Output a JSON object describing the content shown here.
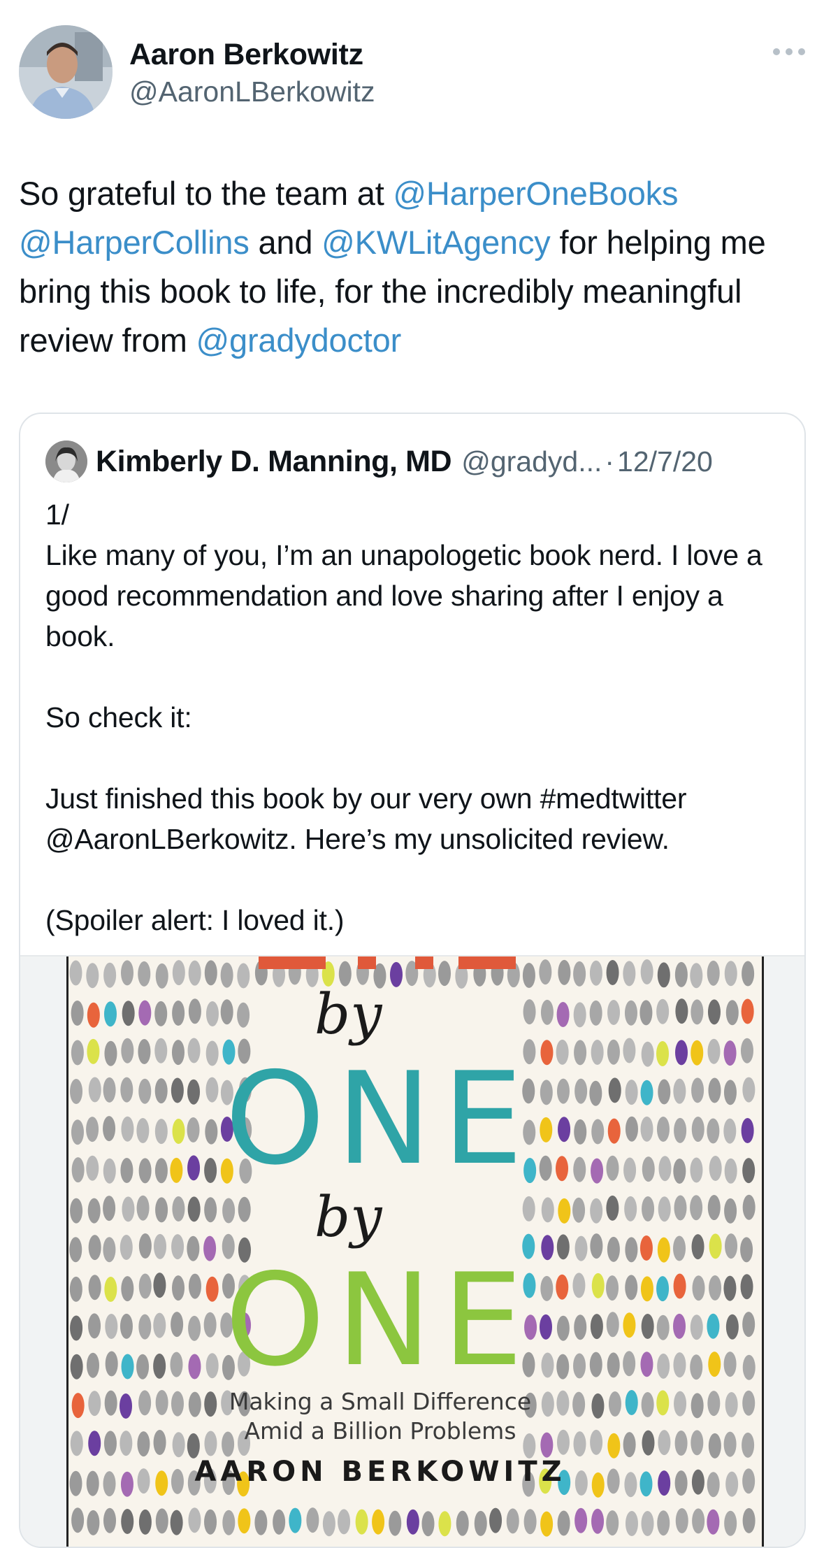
{
  "author": {
    "name": "Aaron Berkowitz",
    "handle": "@AaronLBerkowitz"
  },
  "tweet": {
    "segments": [
      {
        "text": "So grateful to the team at ",
        "mention": false
      },
      {
        "text": "@HarperOneBooks",
        "mention": true
      },
      {
        "text": " ",
        "mention": false
      },
      {
        "text": "@HarperCollins",
        "mention": true
      },
      {
        "text": " and ",
        "mention": false
      },
      {
        "text": "@KWLitAgency",
        "mention": true
      },
      {
        "text": " for helping me bring this book to life, for the incredibly meaningful review from ",
        "mention": false
      },
      {
        "text": "@gradydoctor",
        "mention": true
      }
    ]
  },
  "quote": {
    "name": "Kimberly D. Manning, MD",
    "handle": "@gradyd...",
    "separator": "·",
    "date": "12/7/20",
    "lines": [
      "1/",
      "Like many of you, I’m an unapologetic book nerd. I love a good recommendation and love sharing after I enjoy a book.",
      "",
      "So check it:",
      "",
      "Just finished this book by our very own #medtwitter @AaronLBerkowitz. Here’s my unsolicited review.",
      "",
      "(Spoiler alert: I loved it.)"
    ]
  },
  "book": {
    "by1": "by",
    "one1": "ONE",
    "by2": "by",
    "one2": "ONE",
    "subtitle1": "Making a Small Difference",
    "subtitle2": "Amid a Billion Problems",
    "author": "AARON BERKOWITZ",
    "colors": {
      "title_top": "#e0593a",
      "title_mid": "#2fa4a7",
      "title_bottom": "#8cc63f",
      "dots": [
        "#a7a7a7",
        "#b8b8b8",
        "#9a9a9a",
        "#6f6f6f",
        "#f0c419",
        "#dbe24a",
        "#3fb5c9",
        "#a46ab3",
        "#e8643c",
        "#6b3fa0"
      ]
    }
  }
}
